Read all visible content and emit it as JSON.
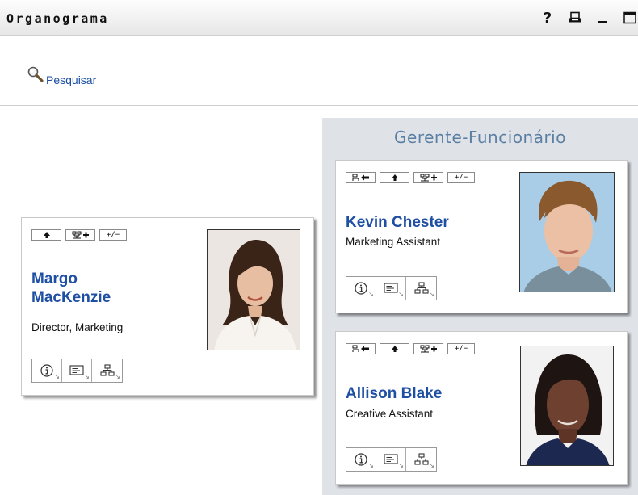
{
  "window": {
    "title": "Organograma"
  },
  "search": {
    "label": "Pesquisar"
  },
  "panel": {
    "title": "Gerente-Funcionário"
  },
  "controls": {
    "expand_label": "+/−"
  },
  "people": [
    {
      "name_line1": "Margo",
      "name_line2": "MacKenzie",
      "title": "Director, Marketing"
    },
    {
      "name": "Kevin Chester",
      "title": "Marketing Assistant"
    },
    {
      "name": "Allison Blake",
      "title": "Creative Assistant"
    }
  ],
  "icons": [
    "help-icon",
    "print-icon",
    "minimize-icon",
    "maximize-icon",
    "magnifier-icon",
    "up-arrow-icon",
    "org-expand-icon",
    "info-icon",
    "card-icon",
    "hierarchy-icon"
  ]
}
